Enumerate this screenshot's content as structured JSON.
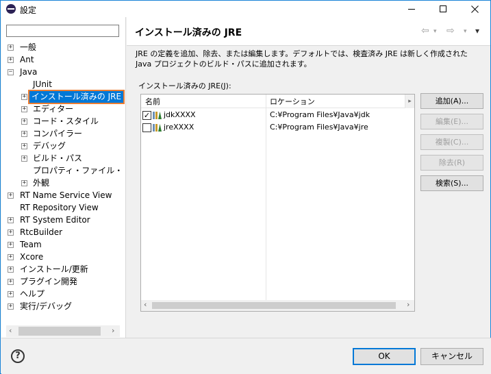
{
  "window": {
    "title": "設定"
  },
  "filter": {
    "value": "",
    "placeholder": ""
  },
  "tree": [
    {
      "label": "一般",
      "expander": "+"
    },
    {
      "label": "Ant",
      "expander": "+"
    },
    {
      "label": "Java",
      "expander": "−"
    },
    {
      "label": "JUnit",
      "expander": ""
    },
    {
      "label": "インストール済みの JRE",
      "expander": "+"
    },
    {
      "label": "エディター",
      "expander": "+"
    },
    {
      "label": "コード・スタイル",
      "expander": "+"
    },
    {
      "label": "コンパイラー",
      "expander": "+"
    },
    {
      "label": "デバッグ",
      "expander": "+"
    },
    {
      "label": "ビルド・パス",
      "expander": "+"
    },
    {
      "label": "プロパティ・ファイル・エディタ・",
      "expander": ""
    },
    {
      "label": "外観",
      "expander": "+"
    },
    {
      "label": "RT Name Service View",
      "expander": "+"
    },
    {
      "label": "RT Repository View",
      "expander": ""
    },
    {
      "label": "RT System Editor",
      "expander": "+"
    },
    {
      "label": "RtcBuilder",
      "expander": "+"
    },
    {
      "label": "Team",
      "expander": "+"
    },
    {
      "label": "Xcore",
      "expander": "+"
    },
    {
      "label": "インストール/更新",
      "expander": "+"
    },
    {
      "label": "プラグイン開発",
      "expander": "+"
    },
    {
      "label": "ヘルプ",
      "expander": "+"
    },
    {
      "label": "実行/デバッグ",
      "expander": "+"
    }
  ],
  "page": {
    "title": "インストール済みの JRE",
    "description": "JRE の定義を追加、除去、または編集します。デフォルトでは、検査済み JRE は新しく作成された Java プロジェクトのビルド・パスに追加されます。",
    "table_label": "インストール済みの JRE(J):",
    "columns": [
      "名前",
      "ロケーション"
    ],
    "rows": [
      {
        "checked": true,
        "checkmark": "✓",
        "name": "jdkXXXX",
        "location": "C:¥Program Files¥Java¥jdk"
      },
      {
        "checked": false,
        "checkmark": "",
        "name": "jreXXXX",
        "location": "C:¥Program Files¥Java¥jre"
      }
    ],
    "buttons": {
      "add": "追加(A)...",
      "edit": "編集(E)...",
      "duplicate": "複製(C)...",
      "remove": "除去(R)",
      "search": "検索(S)..."
    }
  },
  "nav": {
    "back": "⇦",
    "forward": "⇨",
    "menu": "▾"
  },
  "footer": {
    "help": "?",
    "ok": "OK",
    "cancel": "キャンセル"
  },
  "colors": {
    "selection_highlight": "#ed7d31",
    "selection_bg": "#0078d7",
    "default_button_border": "#0078d7"
  }
}
